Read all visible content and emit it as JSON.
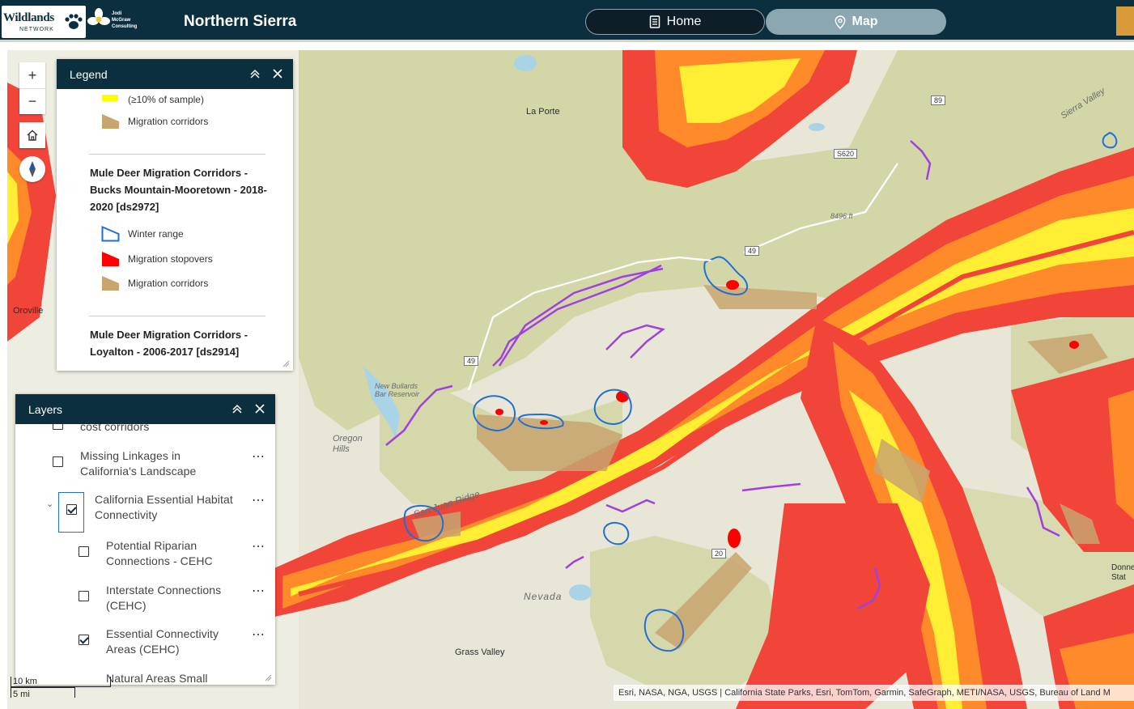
{
  "header": {
    "org_name": "Wildlands",
    "org_sub": "NETWORK",
    "partner_name": "Jodi McGraw Consulting",
    "title": "Northern Sierra",
    "nav": {
      "home_label": "Home",
      "map_label": "Map"
    }
  },
  "map": {
    "labels": {
      "la_porte": "La Porte",
      "sierra_valley": "Sierra Valley",
      "oroville": "Oroville",
      "new_bullards_bar": "New Bullards Bar Reservoir",
      "oregon_hills": "Oregon Hills",
      "san_juan_ridge": "San Juan Ridge",
      "nevada": "Nevada",
      "grass_valley": "Grass Valley",
      "peak_elev": "8496 ft",
      "donner": "Donner Stat"
    },
    "shields": {
      "r89": "89",
      "s620": "S620",
      "r49a": "49",
      "r49b": "49",
      "r20": "20"
    },
    "controls": {
      "zoom_in": "+",
      "zoom_out": "−"
    },
    "scalebar": {
      "km": "10 km",
      "mi": "5 mi"
    },
    "attribution": "Esri, NASA, NGA, USGS | California State Parks, Esri, TomTom, Garmin, SafeGraph, METI/NASA, USGS, Bureau of Land M"
  },
  "legend": {
    "title": "Legend",
    "items_top": [
      {
        "label": "(≥10% of sample)",
        "color": "#ffff00"
      },
      {
        "label": "Migration corridors",
        "color": "#c8a46e"
      }
    ],
    "group1": {
      "title": "Mule Deer Migration Corridors - Bucks Mountain-Mooretown - 2018-2020 [ds2972]",
      "items": [
        {
          "label": "Winter range",
          "color": "#1f6fd6"
        },
        {
          "label": "Migration stopovers",
          "color": "#ff0000"
        },
        {
          "label": "Migration corridors",
          "color": "#c8a46e"
        }
      ]
    },
    "group2": {
      "title": "Mule Deer Migration Corridors - Loyalton - 2006-2017 [ds2914]"
    }
  },
  "layers": {
    "title": "Layers",
    "items": [
      {
        "label": "cost corridors",
        "checked": false
      },
      {
        "label": "Missing Linkages in California's Landscape",
        "checked": false
      },
      {
        "label": "California Essential Habitat Connectivity",
        "checked": true
      },
      {
        "label": "Potential Riparian Connections - CEHC",
        "checked": false
      },
      {
        "label": "Interstate Connections (CEHC)",
        "checked": false
      },
      {
        "label": "Essential Connectivity Areas (CEHC)",
        "checked": true
      },
      {
        "label": "Natural Areas Small",
        "checked": false
      }
    ]
  },
  "colors": {
    "header_bg": "#0b2f3e",
    "corridor_red": "#f2453a",
    "corridor_orange": "#ff8a2a",
    "corridor_yellow": "#ffee33",
    "public_land": "#d3d7a8",
    "winter_range": "#1f6fd6",
    "stopover": "#ff0000",
    "migration_corridor": "#c8a46e",
    "trail_purple": "#a040e0"
  }
}
